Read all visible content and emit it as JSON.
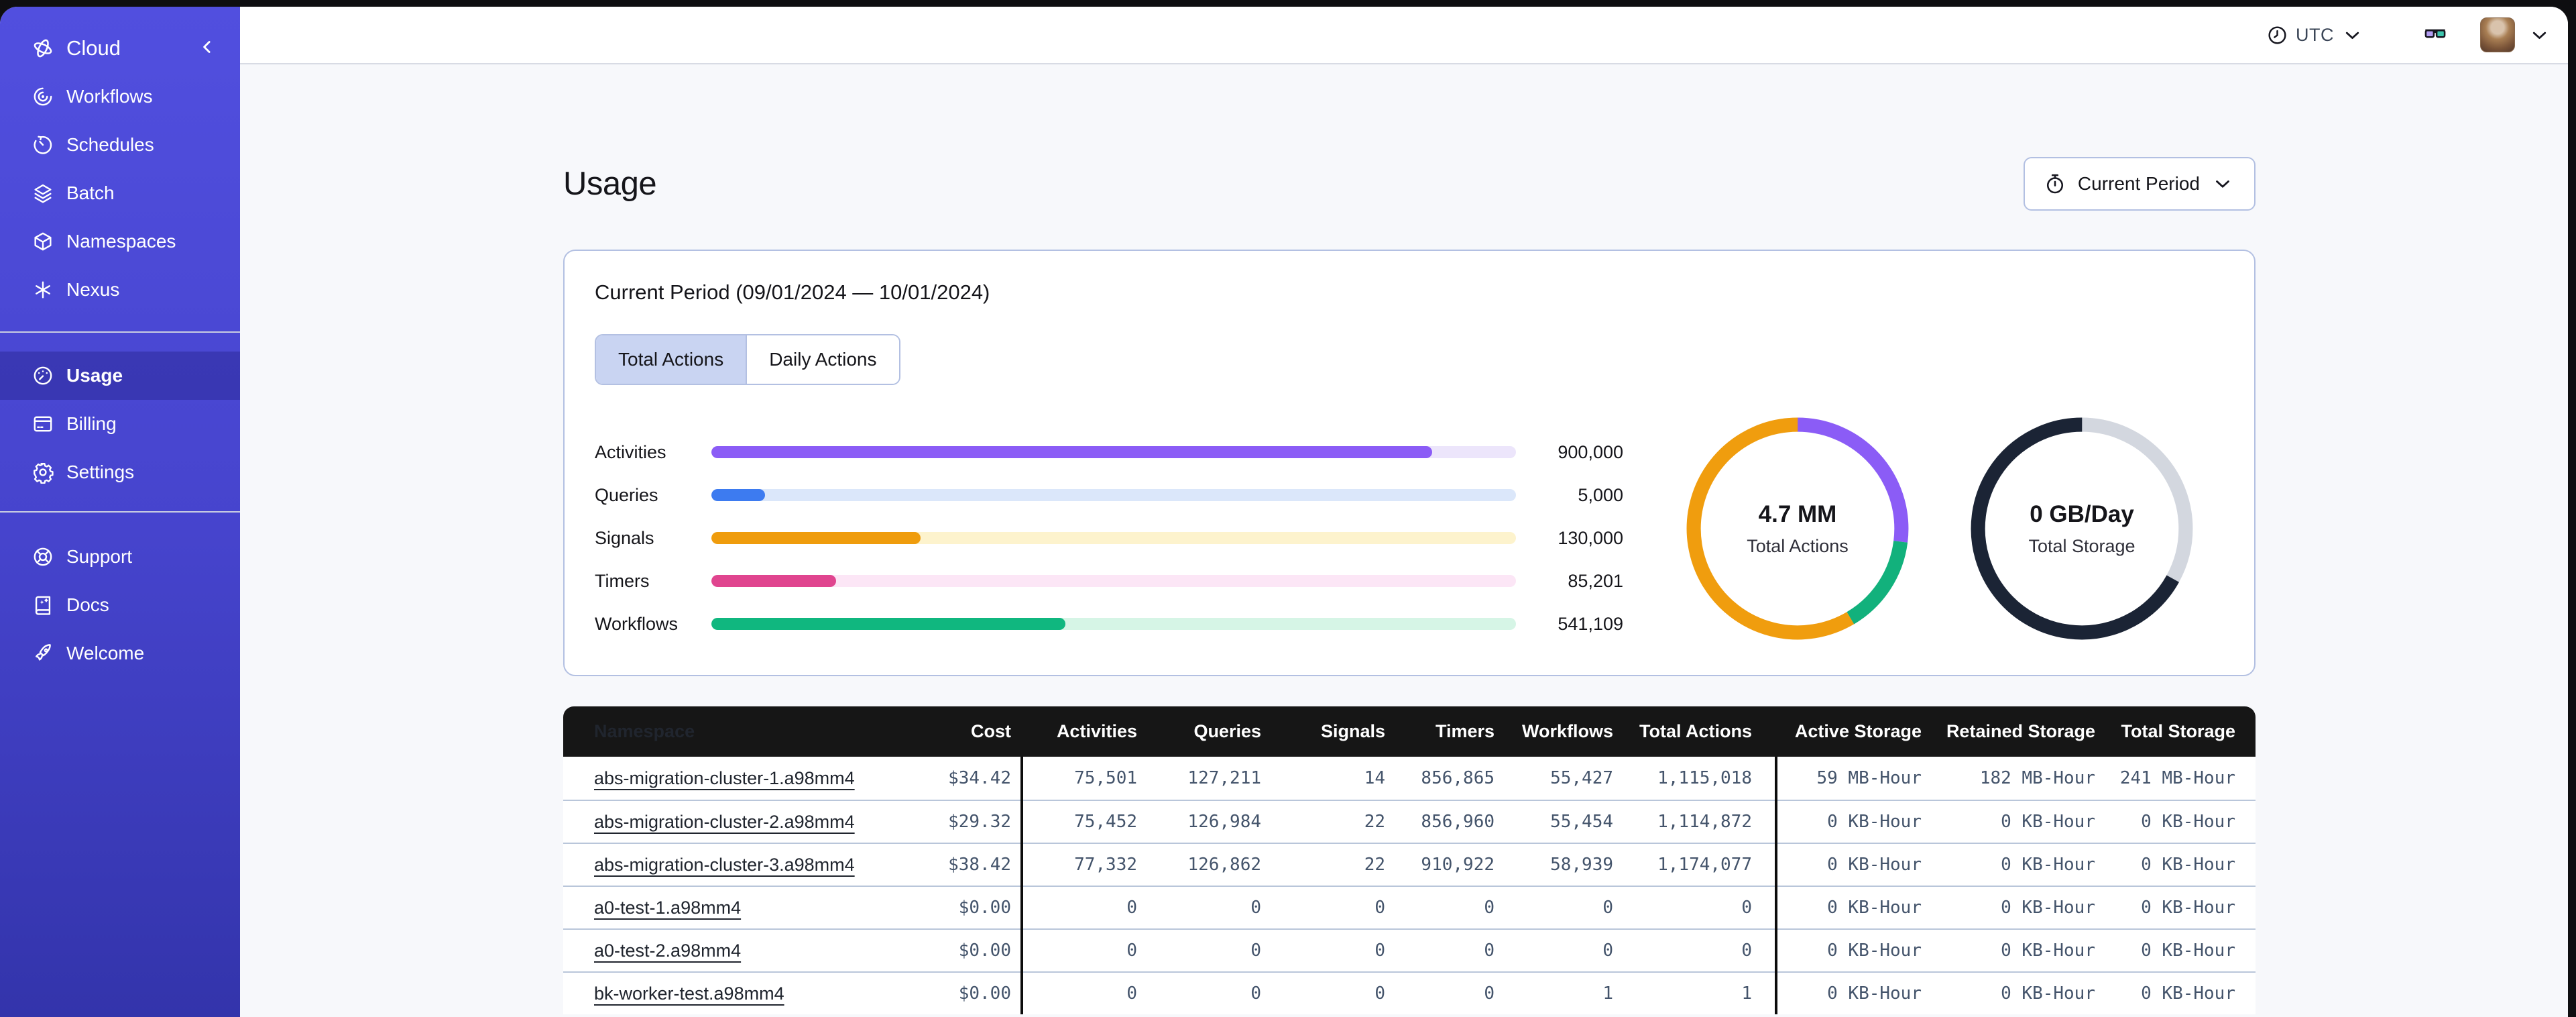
{
  "colors": {
    "sidebar_top": "#514fdf",
    "sidebar_bottom": "#3334ab",
    "accent_border": "#b3c0e2",
    "selected_tab_bg": "#c9d4f2",
    "table_header_bg": "#161616",
    "row_divider": "#b9c6da",
    "content_bg": "#f7f8fb"
  },
  "sidebar": {
    "brand": {
      "label": "Cloud",
      "icon": "temporal-logo"
    },
    "sections": [
      {
        "items": [
          {
            "label": "Workflows",
            "icon": "workflows"
          },
          {
            "label": "Schedules",
            "icon": "schedules"
          },
          {
            "label": "Batch",
            "icon": "batch"
          },
          {
            "label": "Namespaces",
            "icon": "namespaces"
          },
          {
            "label": "Nexus",
            "icon": "nexus"
          }
        ]
      },
      {
        "items": [
          {
            "label": "Usage",
            "icon": "usage",
            "active": true
          },
          {
            "label": "Billing",
            "icon": "billing"
          },
          {
            "label": "Settings",
            "icon": "settings"
          }
        ]
      },
      {
        "items": [
          {
            "label": "Support",
            "icon": "support"
          },
          {
            "label": "Docs",
            "icon": "docs"
          },
          {
            "label": "Welcome",
            "icon": "welcome"
          }
        ]
      }
    ]
  },
  "topbar": {
    "timezone_label": "UTC"
  },
  "page": {
    "title": "Usage",
    "period_button_label": "Current Period"
  },
  "usage_card": {
    "title": "Current Period (09/01/2024 — 10/01/2024)",
    "tabs": [
      {
        "label": "Total Actions",
        "selected": true
      },
      {
        "label": "Daily Actions",
        "selected": false
      }
    ]
  },
  "chart_data": [
    {
      "type": "bar",
      "orientation": "horizontal",
      "categories": [
        "Activities",
        "Queries",
        "Signals",
        "Timers",
        "Workflows"
      ],
      "values": [
        900000,
        5000,
        130000,
        85201,
        541109
      ],
      "value_labels": [
        "900,000",
        "5,000",
        "130,000",
        "85,201",
        "541,109"
      ],
      "percent_filled": [
        89.6,
        6.7,
        26,
        15.5,
        44
      ],
      "colors": [
        "#8b5cf6",
        "#3d7bf0",
        "#ef9c0d",
        "#e0458f",
        "#10b77f"
      ],
      "track_colors": [
        "#ece5fb",
        "#dbe7fa",
        "#fdf3cd",
        "#fce6f6",
        "#d6f5e6"
      ],
      "title": "",
      "xlabel": "",
      "ylabel": "",
      "grid": false,
      "legend": false
    },
    {
      "type": "donut",
      "center_value": "4.7 MM",
      "center_label": "Total Actions",
      "segments": [
        {
          "name": "Activities",
          "color": "#8b5cf6",
          "percent": 27
        },
        {
          "name": "Workflows",
          "color": "#12b17c",
          "percent": 14.5
        },
        {
          "name": "Signals",
          "color": "#f09d0e",
          "percent": 58.5
        }
      ]
    },
    {
      "type": "donut",
      "center_value": "0 GB/Day",
      "center_label": "Total Storage",
      "segments": [
        {
          "name": "remaining-storage",
          "color": "#d3d7df",
          "percent": 33
        },
        {
          "name": "used-storage",
          "color": "#1b2435",
          "percent": 67
        }
      ]
    }
  ],
  "table": {
    "columns": [
      "Namespace",
      "Cost",
      "Activities",
      "Queries",
      "Signals",
      "Timers",
      "Workflows",
      "Total Actions",
      "Active Storage",
      "Retained Storage",
      "Total Storage"
    ],
    "rows": [
      [
        "abs-migration-cluster-1.a98mm4",
        "$34.42",
        "75,501",
        "127,211",
        "14",
        "856,865",
        "55,427",
        "1,115,018",
        "59 MB-Hour",
        "182 MB-Hour",
        "241 MB-Hour"
      ],
      [
        "abs-migration-cluster-2.a98mm4",
        "$29.32",
        "75,452",
        "126,984",
        "22",
        "856,960",
        "55,454",
        "1,114,872",
        "0 KB-Hour",
        "0 KB-Hour",
        "0 KB-Hour"
      ],
      [
        "abs-migration-cluster-3.a98mm4",
        "$38.42",
        "77,332",
        "126,862",
        "22",
        "910,922",
        "58,939",
        "1,174,077",
        "0 KB-Hour",
        "0 KB-Hour",
        "0 KB-Hour"
      ],
      [
        "a0-test-1.a98mm4",
        "$0.00",
        "0",
        "0",
        "0",
        "0",
        "0",
        "0",
        "0 KB-Hour",
        "0 KB-Hour",
        "0 KB-Hour"
      ],
      [
        "a0-test-2.a98mm4",
        "$0.00",
        "0",
        "0",
        "0",
        "0",
        "0",
        "0",
        "0 KB-Hour",
        "0 KB-Hour",
        "0 KB-Hour"
      ],
      [
        "bk-worker-test.a98mm4",
        "$0.00",
        "0",
        "0",
        "0",
        "0",
        "1",
        "1",
        "0 KB-Hour",
        "0 KB-Hour",
        "0 KB-Hour"
      ]
    ]
  }
}
